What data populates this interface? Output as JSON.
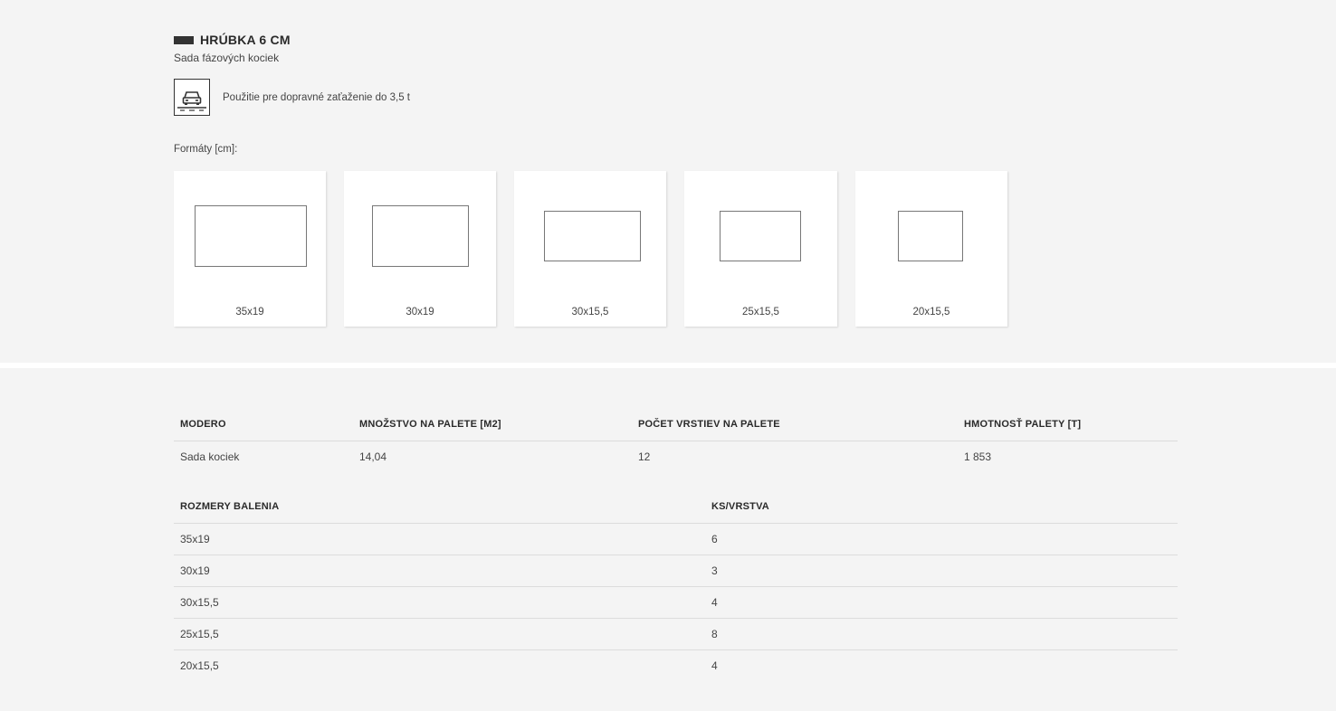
{
  "product": {
    "thickness_title": "HRÚBKA 6 CM",
    "subtitle": "Sada fázových kociek",
    "usage_icon": "car-icon",
    "usage_text": "Použitie pre dopravné zaťaženie do 3,5 t"
  },
  "formats": {
    "label": "Formáty [cm]:",
    "items": [
      {
        "label": "35x19"
      },
      {
        "label": "30x19"
      },
      {
        "label": "30x15,5"
      },
      {
        "label": "25x15,5"
      },
      {
        "label": "20x15,5"
      }
    ]
  },
  "spec_table": {
    "headers": [
      "MODERO",
      "MNOŽSTVO NA PALETE [M2]",
      "POČET VRSTIEV NA PALETE",
      "HMOTNOSŤ PALETY [T]"
    ],
    "rows": [
      [
        "Sada kociek",
        "14,04",
        "12",
        "1 853"
      ]
    ]
  },
  "pack_table": {
    "headers": [
      "ROZMERY BALENIA",
      "KS/VRSTVA"
    ],
    "rows": [
      [
        "35x19",
        "6"
      ],
      [
        "30x19",
        "3"
      ],
      [
        "30x15,5",
        "4"
      ],
      [
        "25x15,5",
        "8"
      ],
      [
        "20x15,5",
        "4"
      ]
    ]
  }
}
